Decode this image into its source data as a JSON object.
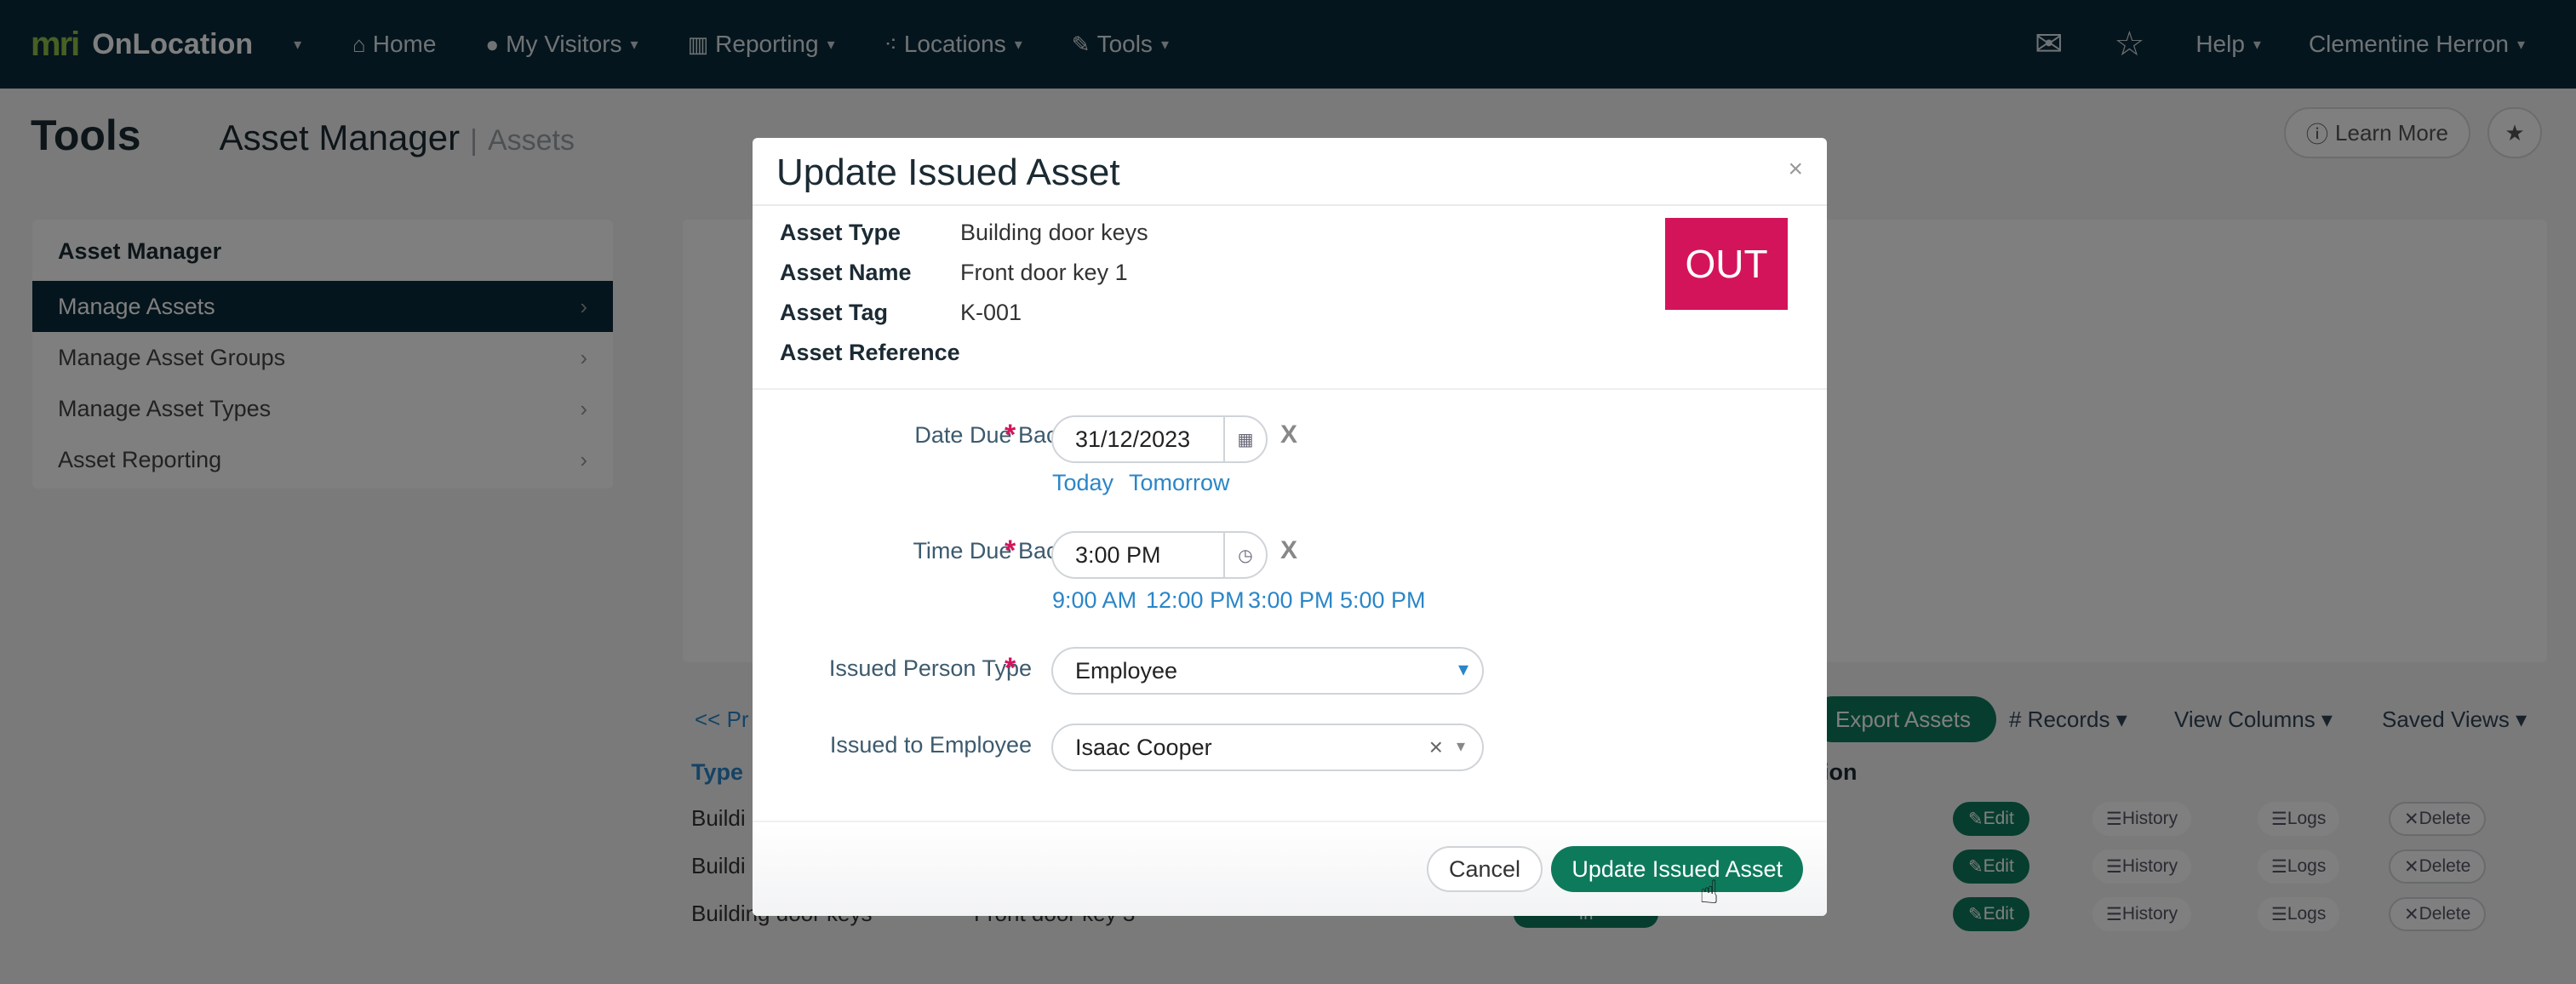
{
  "nav": {
    "brand_mark": "mri",
    "brand_name": "OnLocation",
    "items": [
      {
        "label": "Home",
        "icon": "home-icon"
      },
      {
        "label": "My Visitors",
        "icon": "user-icon"
      },
      {
        "label": "Reporting",
        "icon": "chart-icon"
      },
      {
        "label": "Locations",
        "icon": "network-icon"
      },
      {
        "label": "Tools",
        "icon": "wrench-icon"
      }
    ],
    "help": "Help",
    "user": "Clementine Herron"
  },
  "header": {
    "title": "Tools",
    "crumb_main": "Asset Manager",
    "crumb_sep": "|",
    "crumb_sub": "Assets",
    "learn_more": "Learn More"
  },
  "sidebar": {
    "title": "Asset Manager",
    "items": [
      {
        "label": "Manage Assets",
        "active": true
      },
      {
        "label": "Manage Asset Groups"
      },
      {
        "label": "Manage Asset Types"
      },
      {
        "label": "Asset Reporting"
      }
    ]
  },
  "toolbar": {
    "prev": "<< Pr",
    "export": "Export Assets",
    "records": "# Records",
    "view_columns": "View Columns",
    "saved_views": "Saved Views"
  },
  "table": {
    "col_type": "Type",
    "col_action": "tion",
    "rows": [
      {
        "type": "Buildi",
        "name": "",
        "status": ""
      },
      {
        "type": "Buildi",
        "name": "",
        "status": ""
      },
      {
        "type": "Building door keys",
        "name": "Front door key 3",
        "status": "In"
      }
    ],
    "edit": "Edit",
    "history": "History",
    "logs": "Logs",
    "delete": "Delete"
  },
  "modal": {
    "title": "Update Issued Asset",
    "close": "×",
    "badge": "OUT",
    "badge_color": "#d4145a",
    "info": [
      {
        "label": "Asset Type",
        "value": "Building door keys"
      },
      {
        "label": "Asset Name",
        "value": "Front door key 1"
      },
      {
        "label": "Asset Tag",
        "value": "K-001"
      },
      {
        "label": "Asset Reference",
        "value": ""
      }
    ],
    "date_label": "Date Due Back",
    "date_value": "31/12/2023",
    "date_quick": [
      "Today",
      "Tomorrow"
    ],
    "time_label": "Time Due Back",
    "time_value": "3:00 PM",
    "time_quick": [
      "9:00 AM",
      "12:00 PM",
      "3:00 PM",
      "5:00 PM"
    ],
    "person_type_label": "Issued Person Type",
    "person_type_value": "Employee",
    "employee_label": "Issued to Employee",
    "employee_value": "Isaac Cooper",
    "required_mark": "*",
    "clear_mark": "X",
    "cancel": "Cancel",
    "submit": "Update Issued Asset",
    "primary_color": "#0e7a5c"
  }
}
